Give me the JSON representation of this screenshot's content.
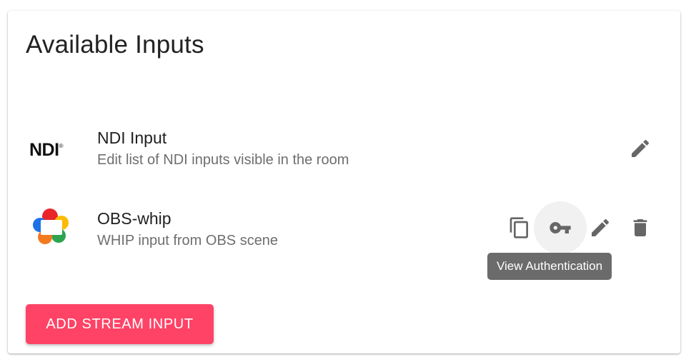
{
  "card": {
    "title": "Available Inputs"
  },
  "inputs": [
    {
      "logo_text": "NDI",
      "logo_mark": "®",
      "name": "NDI Input",
      "description": "Edit list of NDI inputs visible in the room",
      "actions": [
        "edit-icon"
      ]
    },
    {
      "logo_icon": "webrtc-logo-icon",
      "name": "OBS-whip",
      "description": "WHIP input from OBS scene",
      "actions": [
        "copy-icon",
        "key-icon",
        "edit-icon",
        "delete-icon"
      ]
    }
  ],
  "tooltip": {
    "text": "View Authentication"
  },
  "add_button": {
    "label": "ADD STREAM INPUT"
  },
  "colors": {
    "accent": "#ff4366",
    "icon": "#666666",
    "tooltip_bg": "#6b6b6b"
  }
}
